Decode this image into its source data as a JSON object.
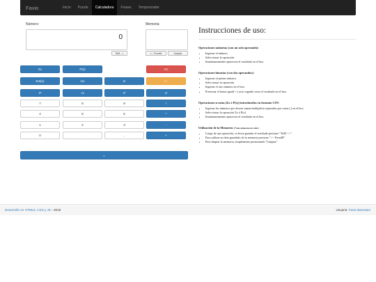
{
  "navbar": {
    "brand": "Favio",
    "items": [
      {
        "label": "Inicio",
        "active": false
      },
      {
        "label": "Puzzle",
        "active": false
      },
      {
        "label": "Calculadora",
        "active": true
      },
      {
        "label": "Frases",
        "active": false
      },
      {
        "label": "Temporizador",
        "active": false
      }
    ]
  },
  "calculator": {
    "numero_label": "Número:",
    "numero_value": "0",
    "tom_button": "ToM -->",
    "memoria_label": "Memoria:",
    "memoria_value": "",
    "fromm_button": "<-- FromM",
    "limpiar_button": "Limpiar",
    "equals_label": "=",
    "keys": [
      [
        {
          "label": "Σx",
          "style": "blue"
        },
        {
          "label": "P(x)",
          "style": "blue"
        },
        null,
        {
          "label": "AC",
          "style": "red"
        }
      ],
      [
        {
          "label": "Ent(x)",
          "style": "blue"
        },
        {
          "label": "1/x",
          "style": "blue"
        },
        {
          "label": "n!",
          "style": "blue"
        },
        {
          "label": "<--",
          "style": "orange"
        }
      ],
      [
        {
          "label": "2ˣ",
          "style": "blue"
        },
        {
          "label": "√x",
          "style": "blue"
        },
        {
          "label": "x²",
          "style": "blue"
        },
        {
          "label": "xʸ",
          "style": "blue"
        }
      ],
      [
        {
          "label": "7",
          "style": "white"
        },
        {
          "label": "8",
          "style": "white"
        },
        {
          "label": "9",
          "style": "white"
        },
        {
          "label": "/",
          "style": "blue"
        }
      ],
      [
        {
          "label": "4",
          "style": "white"
        },
        {
          "label": "5",
          "style": "white"
        },
        {
          "label": "6",
          "style": "white"
        },
        {
          "label": "*",
          "style": "blue"
        }
      ],
      [
        {
          "label": "1",
          "style": "white"
        },
        {
          "label": "2",
          "style": "white"
        },
        {
          "label": "3",
          "style": "white"
        },
        {
          "label": "-",
          "style": "blue"
        }
      ],
      [
        {
          "label": "0",
          "style": "white"
        },
        {
          "label": ".",
          "style": "white"
        },
        {
          "label": ",",
          "style": "white"
        },
        {
          "label": "+",
          "style": "blue"
        }
      ]
    ]
  },
  "instructions": {
    "title": "Instrucciones de uso:",
    "sections": [
      {
        "title": "Operaciones unitarias (con un solo operando):",
        "items": [
          "Ingresar el número.",
          "Seleccionar la operación",
          "Instantaneamente aparecera el resultado en el box."
        ]
      },
      {
        "title": "Operaciones binarias (con dos operandos):",
        "items": [
          "Ingresar el primer número.",
          "Seleccionar la operación",
          "Ingresar el otro número en el box.",
          "Presionar el boton igual( = ) acto seguido veras el resultado en el box."
        ]
      },
      {
        "title": "Operaciones n-arias (Σx ó P(x)) introducidos en formato CSV:",
        "items": [
          "Ingresar los números que deseas sumar/multiplicar separados por coma (,) en el box.",
          "Seleccionar la operación Σx ó P(x)",
          "Instantaneamente aparecera el resultado en el box."
        ]
      },
      {
        "title": "Utilización de la Memoria:",
        "title_small": "(*Solo almacena un valor)",
        "items": [
          "Luego de una operación, si desea guardar el resultado presione \"ToM -->\".",
          "Para utilizar un dato guardado de la memoria presione \"<-- FromM\"",
          "Para limpiar la memoria, simplemente presionando \"Limpiar\""
        ]
      }
    ]
  },
  "footer": {
    "left_link": "Desarrollo en HTML5, CSS y JS",
    "left_suffix": " - 2018",
    "right_label": "Usuario: ",
    "right_link": "Favio Barnatan"
  }
}
